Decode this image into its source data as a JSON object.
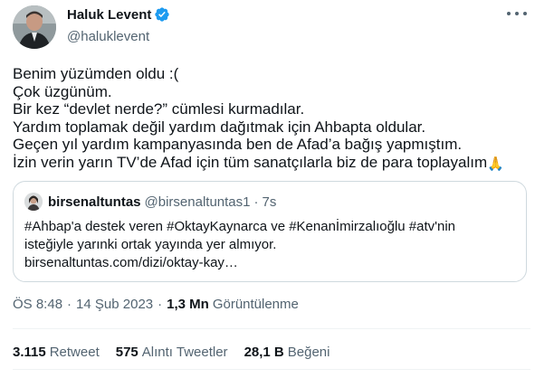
{
  "author": {
    "name": "Haluk Levent",
    "handle": "@haluklevent"
  },
  "tweet": {
    "lines": [
      "Benim yüzümden oldu :(",
      "Çok üzgünüm.",
      "Bir kez “devlet nerde?” cümlesi kurmadılar.",
      "Yardım toplamak değil yardım dağıtmak için Ahbapta oldular.",
      "Geçen yıl yardım kampanyasında ben de Afad’a bağış yapmıştım.",
      "İzin verin yarın TV’de Afad için tüm sanatçılarla biz de para toplayalım"
    ],
    "emoji": "🙏"
  },
  "quote": {
    "name": "birsenaltuntas",
    "handle": "@birsenaltuntas1",
    "separator": "·",
    "time": "7s",
    "lines": [
      "#Ahbap'a destek veren #OktayKaynarca ve #Kenanİmirzalıoğlu #atv'nin",
      "isteğiyle yarınki ortak yayında yer almıyor.",
      "birsenaltuntas.com/dizi/oktay-kay…"
    ]
  },
  "meta": {
    "time": "ÖS 8:48",
    "separator": "·",
    "date": "14 Şub 2023",
    "views_count": "1,3 Mn",
    "views_label": "Görüntülenme"
  },
  "stats": {
    "retweets_count": "3.115",
    "retweets_label": "Retweet",
    "quotes_count": "575",
    "quotes_label": "Alıntı Tweetler",
    "likes_count": "28,1 B",
    "likes_label": "Beğeni"
  },
  "colors": {
    "text": "#0f1419",
    "secondary": "#536471",
    "verified": "#1d9bf0",
    "border": "#cfd9de"
  }
}
